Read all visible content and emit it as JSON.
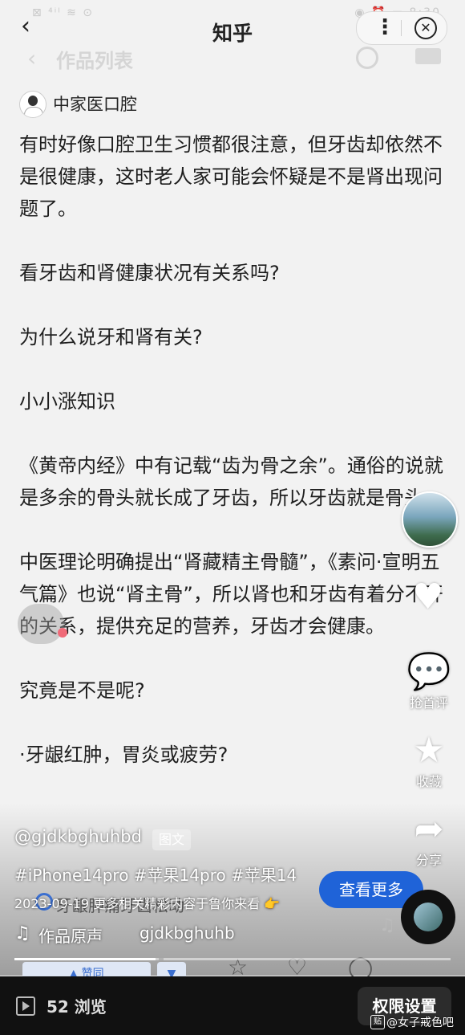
{
  "status": {
    "left": "⊠ ⁴ⁱˡ ≋ ⊙",
    "right": "◉ ⏰ ▭ 8:30"
  },
  "header": {
    "back_icon": "chevron-left-icon",
    "title": "知乎",
    "more_icon": "more-dots-icon",
    "close_icon": "close-circle-icon"
  },
  "list_header": {
    "title": "作品列表"
  },
  "author": {
    "name": "中家医口腔"
  },
  "article": {
    "paragraphs": [
      "有时好像口腔卫生习惯都很注意，但牙齿却依然不是很健康，这时老人家可能会怀疑是不是肾出现问题了。",
      "看牙齿和肾健康状况有关系吗?",
      "为什么说牙和肾有关?",
      "小小涨知识",
      "《黄帝内经》中有记载“齿为骨之余”。通俗的说就是多余的骨头就长成了牙齿，所以牙齿就是骨头。",
      "中医理论明确提出“肾藏精主骨髓”，《素问·宣明五气篇》也说“肾主骨”，所以肾也和牙齿有着分不开的关系，提供充足的营养，牙齿才会健康。",
      "究竟是不是呢?",
      "·牙龈红肿，胃炎或疲劳?"
    ]
  },
  "side": {
    "comment_label": "抢首评",
    "favorite_label": "收藏",
    "share_label": "分享"
  },
  "overlay": {
    "handle": "@gjdkbghuhbd",
    "badge": "图文",
    "tags": "#iPhone14pro #苹果14pro #苹果14",
    "behind_text": "牙龈肿痛牙齿松动",
    "date_text": "2023-09-19  更多相关精彩内容于鲁你来看 👉",
    "more_button": "查看更多",
    "music_label": "作品原声",
    "music_author": "gjdkbghuhb"
  },
  "toolbar_glimpse": {
    "vote_label": "赞同",
    "down_label": "▼"
  },
  "bottom": {
    "views": "52 浏览",
    "permission_button": "权限设置",
    "watermark": "@女子戒色吧"
  }
}
